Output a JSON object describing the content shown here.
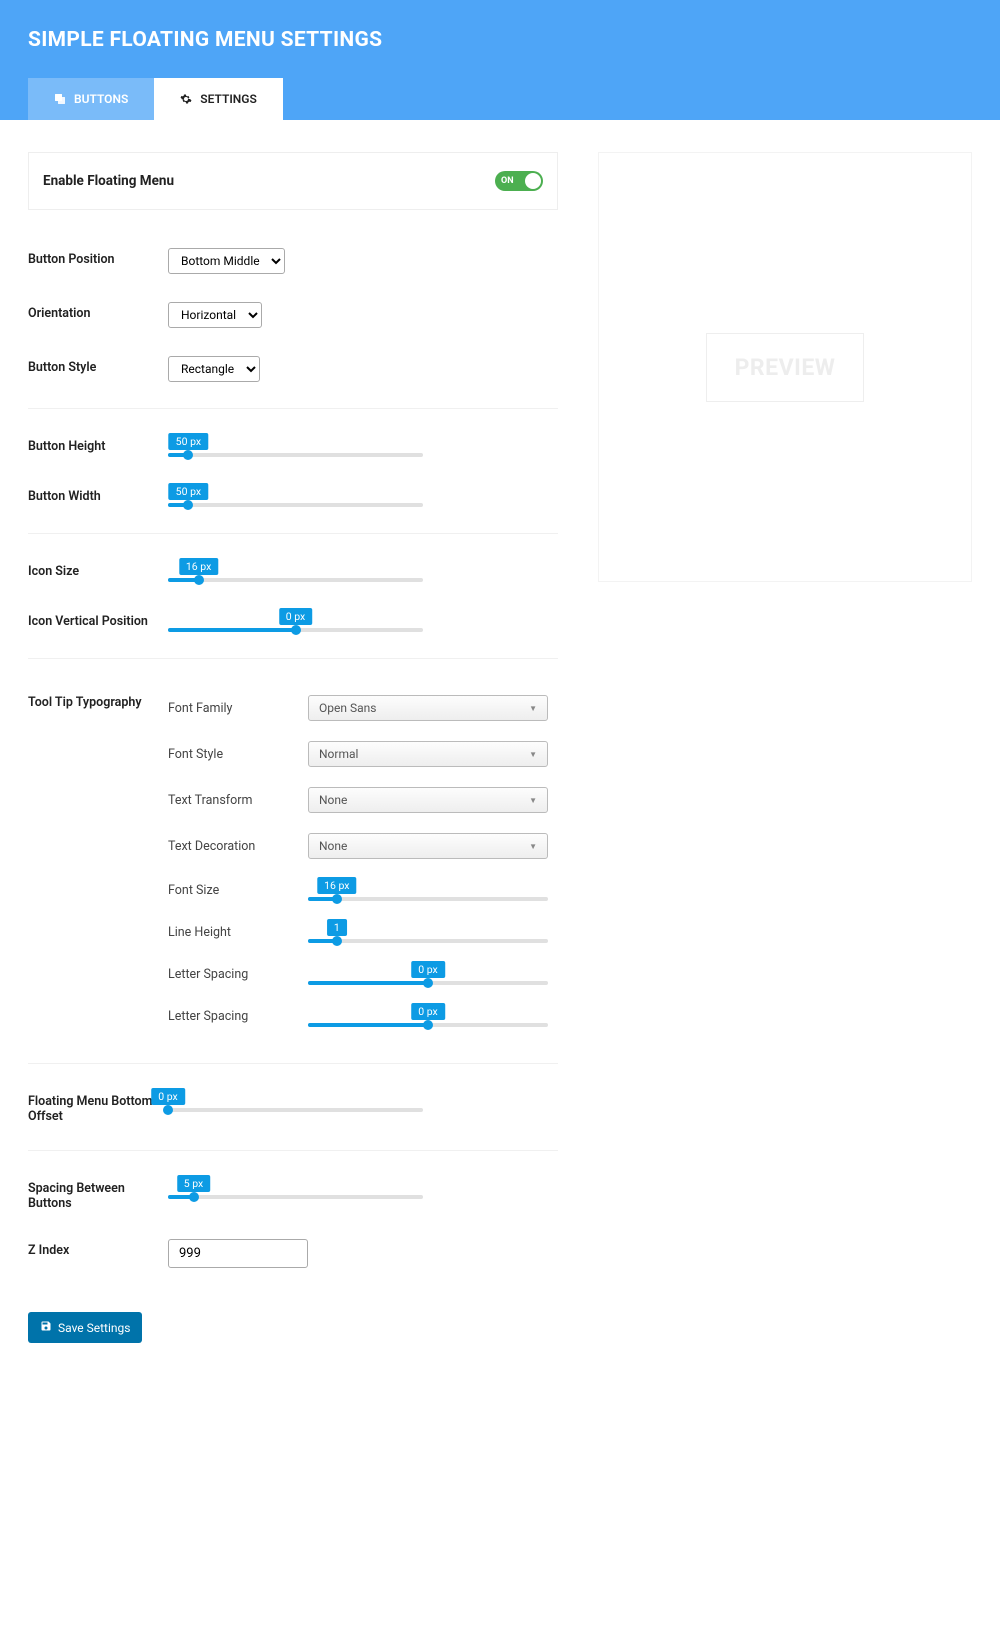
{
  "header": {
    "title": "SIMPLE FLOATING MENU SETTINGS"
  },
  "tabs": {
    "buttons": "BUTTONS",
    "settings": "SETTINGS"
  },
  "enable": {
    "label": "Enable Floating Menu",
    "state": "ON"
  },
  "fields": {
    "button_position": {
      "label": "Button Position",
      "value": "Bottom Middle"
    },
    "orientation": {
      "label": "Orientation",
      "value": "Horizontal"
    },
    "button_style": {
      "label": "Button Style",
      "value": "Rectangle"
    },
    "button_height": {
      "label": "Button Height",
      "value": "50 px",
      "pct": 8
    },
    "button_width": {
      "label": "Button Width",
      "value": "50 px",
      "pct": 8
    },
    "icon_size": {
      "label": "Icon Size",
      "value": "16 px",
      "pct": 12
    },
    "icon_vpos": {
      "label": "Icon Vertical Position",
      "value": "0 px",
      "pct": 50
    },
    "bottom_offset": {
      "label": "Floating Menu Bottom Offset",
      "value": "0 px",
      "pct": 0
    },
    "spacing": {
      "label": "Spacing Between Buttons",
      "value": "5 px",
      "pct": 10
    },
    "zindex": {
      "label": "Z Index",
      "value": "999"
    }
  },
  "typography": {
    "section_label": "Tool Tip Typography",
    "font_family": {
      "label": "Font Family",
      "value": "Open Sans"
    },
    "font_style": {
      "label": "Font Style",
      "value": "Normal"
    },
    "text_transform": {
      "label": "Text Transform",
      "value": "None"
    },
    "text_decoration": {
      "label": "Text Decoration",
      "value": "None"
    },
    "font_size": {
      "label": "Font Size",
      "value": "16 px",
      "pct": 12
    },
    "line_height": {
      "label": "Line Height",
      "value": "1",
      "pct": 12
    },
    "letter_spacing_1": {
      "label": "Letter Spacing",
      "value": "0 px",
      "pct": 50
    },
    "letter_spacing_2": {
      "label": "Letter Spacing",
      "value": "0 px",
      "pct": 50
    }
  },
  "preview": {
    "label": "PREVIEW"
  },
  "save": {
    "label": "Save Settings"
  }
}
